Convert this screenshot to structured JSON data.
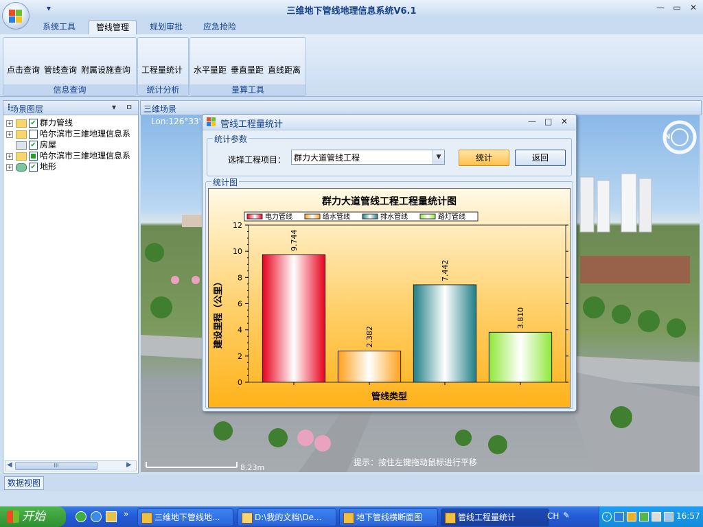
{
  "app": {
    "title": "三维地下管线地理信息系统V6.1",
    "qat_arrow": "▾",
    "window_controls": {
      "minimize": "—",
      "restore": "▭",
      "close": "✕"
    }
  },
  "ribbon": {
    "tabs": [
      "系统工具",
      "管线管理",
      "规划审批",
      "应急抢险"
    ],
    "active_tab": "管线管理",
    "groups": {
      "info": {
        "label": "信息查询",
        "buttons": [
          "点击查询",
          "管线查询",
          "附属设施查询"
        ]
      },
      "stats": {
        "label": "统计分析",
        "buttons": [
          "工程量统计"
        ]
      },
      "measure": {
        "label": "量算工具",
        "buttons": [
          "水平量距",
          "垂直量距",
          "直线距离"
        ]
      }
    }
  },
  "layers_panel": {
    "title": "场景图层",
    "dropdown_glyph": "▾",
    "pin_glyph": "ㅁ",
    "items": [
      {
        "label": "群力管线",
        "checked": true,
        "icon": "folder-icon",
        "expand": "+"
      },
      {
        "label": "哈尔滨市三維地理信息系",
        "checked": false,
        "icon": "folder-icon",
        "expand": "+"
      },
      {
        "label": "房屋",
        "checked": true,
        "icon": "building-layer-icon",
        "expand": ""
      },
      {
        "label": "哈尔滨市三維地理信息系",
        "checked": true,
        "icon": "folder-icon",
        "expand": "+"
      },
      {
        "label": "地形",
        "checked": true,
        "icon": "terrain-icon",
        "expand": "+"
      }
    ],
    "scrollbar_label": "III"
  },
  "scene": {
    "title": "三维场景",
    "coords": "Lon:126°33'0",
    "scale_label": "8.23m",
    "hint": "提示：按住左键拖动鼠标进行平移",
    "compass_label": "N"
  },
  "data_view": {
    "tab_label": "数据视图"
  },
  "dialog": {
    "title": "管线工程量统计",
    "params_legend": "统计参数",
    "select_label": "选择工程项目：",
    "project_value": "群力大道管线工程",
    "stat_button": "统计",
    "back_button": "返回",
    "chart_legend": "统计图",
    "controls": {
      "minimize": "—",
      "maximize": "□",
      "close": "✕"
    }
  },
  "chart_data": {
    "type": "bar",
    "title": "群力大道管线工程工程量统计图",
    "xlabel": "管线类型",
    "ylabel": "建设里程（公里）",
    "ylim": [
      0,
      12
    ],
    "yticks": [
      0,
      2,
      4,
      6,
      8,
      10,
      12
    ],
    "categories": [
      "电力管线",
      "给水管线",
      "排水管线",
      "路灯管线"
    ],
    "values": [
      9.744,
      2.382,
      7.442,
      3.81
    ],
    "value_labels": [
      "9.744",
      "2.382",
      "7.442",
      "3.810"
    ],
    "colors": [
      "#e8001c",
      "#ffa11c",
      "#1e7f86",
      "#8fe83a"
    ],
    "legend_position": "top"
  },
  "taskbar": {
    "start_label": "开始",
    "tasks": [
      {
        "label": "三维地下管线地...",
        "active": false
      },
      {
        "label": "D:\\我的文档\\De...",
        "active": false
      },
      {
        "label": "地下管线横断面图",
        "active": false
      },
      {
        "label": "管线工程量统计",
        "active": true
      }
    ],
    "ime": "CH",
    "clock": "16:57",
    "chevron": "»"
  }
}
